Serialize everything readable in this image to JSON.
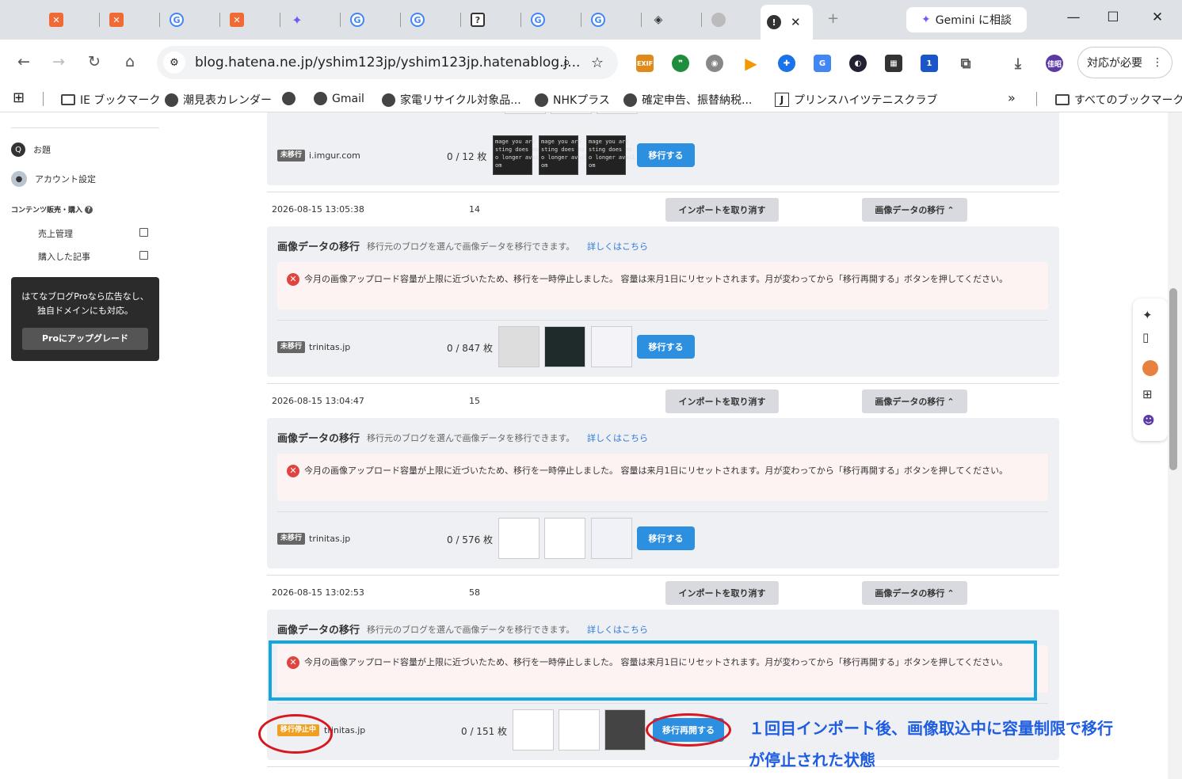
{
  "browser": {
    "gemini_label": "Gemini に相談",
    "url": "blog.hatena.ne.jp/yshim123jp/yshim123jp.hatenablog.j...",
    "action_needed": "対応が必要",
    "profile_initials": "佳昭",
    "ext_badge": "1"
  },
  "bookmarks": [
    {
      "label": "IE ブックマーク"
    },
    {
      "label": "潮見表カレンダー"
    },
    {
      "label": ""
    },
    {
      "label": "Gmail"
    },
    {
      "label": "家電リサイクル対象品..."
    },
    {
      "label": "NHKプラス"
    },
    {
      "label": "確定申告、振替納税..."
    },
    {
      "label": "プリンスハイツテニスクラブ"
    },
    {
      "label": "すべてのブックマーク"
    }
  ],
  "sidebar": {
    "topics": "お題",
    "account": "アカウント設定",
    "content_sales": "コンテンツ販売・購入",
    "sales_mgmt": "売上管理",
    "purchased": "購入した記事",
    "pro_text": "はてなブログProなら広告なし、独自ドメインにも対応。",
    "pro_button": "Proにアップグレード"
  },
  "labels": {
    "cancel_import": "インポートを取り消す",
    "image_migration": "画像データの移行",
    "panel_title": "画像データの移行",
    "panel_desc": "移行元のブログを選んで画像データを移行できます。",
    "panel_link": "詳しくはこちら",
    "alert": "今月の画像アップロード容量が上限に近づいたため、移行を一時停止しました。 容量は来月1日にリセットされます。月が変わってから「移行再開する」ボタンを押してください。",
    "migrate": "移行する",
    "resume": "移行再開する",
    "not_migrated": "未移行",
    "paused": "移行停止中"
  },
  "top_partial": {
    "domain": "i.imgur.com",
    "progress": "0 / 12 枚",
    "thumb_text": "mage you are\nsting does no\no longer avail\nom"
  },
  "imports": [
    {
      "date": "2026-08-15 13:05:38",
      "count": "14",
      "domain": "trinitas.jp",
      "progress": "0 / 847 枚",
      "status": "未移行"
    },
    {
      "date": "2026-08-15 13:04:47",
      "count": "15",
      "domain": "trinitas.jp",
      "progress": "0 / 576 枚",
      "status": "未移行"
    },
    {
      "date": "2026-08-15 13:02:53",
      "count": "58",
      "domain": "trinitas.jp",
      "progress": "0 / 151 枚",
      "status": "移行停止中"
    }
  ],
  "annotation": "１回目インポート後、画像取込中に容量制限で移行が停止された状態"
}
